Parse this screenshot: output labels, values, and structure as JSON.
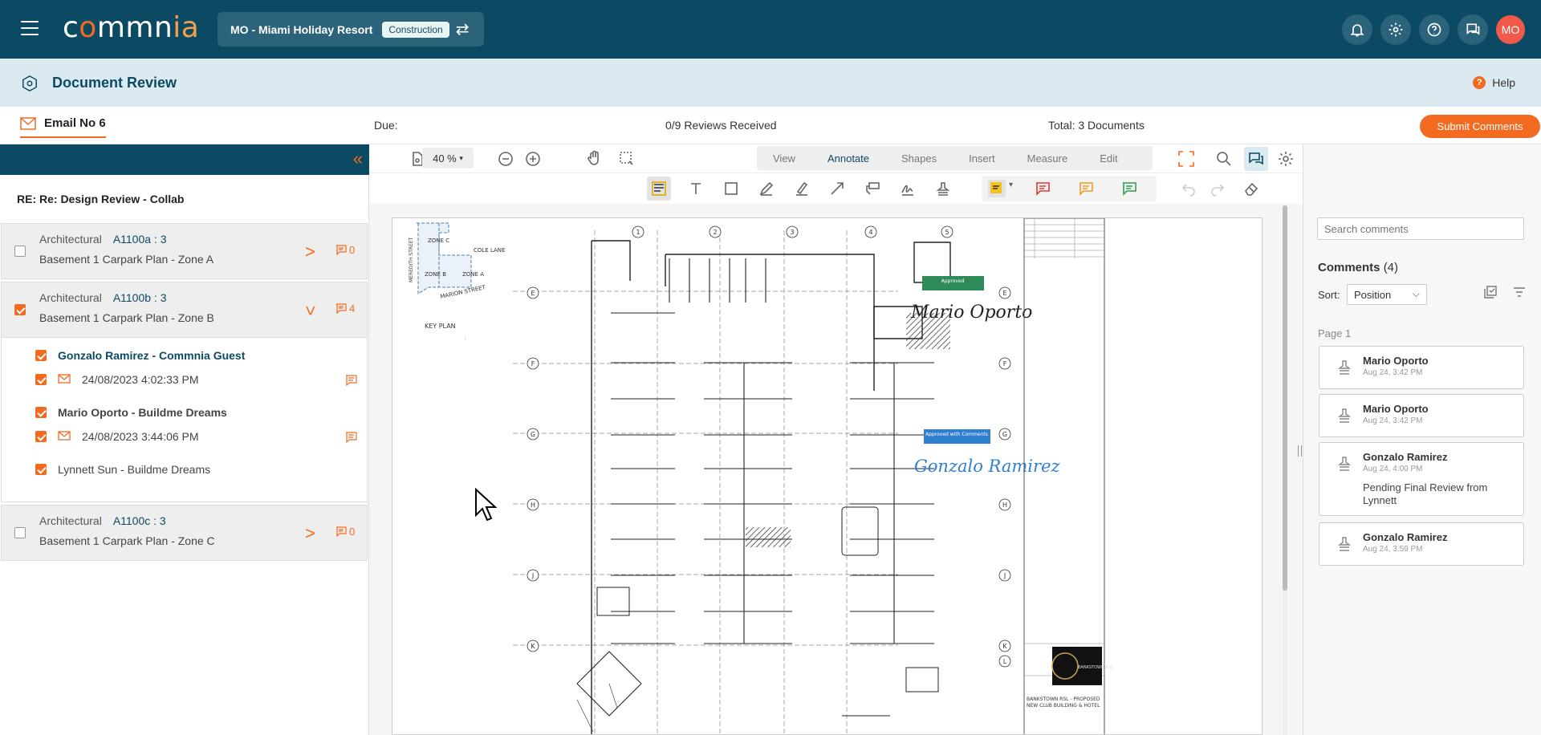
{
  "app": {
    "logo": {
      "c": "c",
      "o": "o",
      "mmn": "mmn",
      "ia": "ia"
    },
    "project": {
      "name": "MO - Miami Holiday Resort",
      "phase": "Construction"
    },
    "avatar_initials": "MO",
    "accent": "#f26b21",
    "primary": "#0c4a63"
  },
  "page": {
    "title": "Document Review",
    "help": "Help"
  },
  "info": {
    "email_tab": "Email No 6",
    "due": "Due:",
    "reviews": "0/9 Reviews Received",
    "total": "Total: 3 Documents",
    "submit": "Submit Comments"
  },
  "left": {
    "subject": "RE: Re: Design Review - Collab",
    "docs": [
      {
        "discipline": "Architectural",
        "code": "A1100a : 3",
        "name": "Basement 1 Carpark Plan - Zone A",
        "comments": "0"
      },
      {
        "discipline": "Architectural",
        "code": "A1100b : 3",
        "name": "Basement 1 Carpark Plan - Zone B",
        "comments": "4"
      },
      {
        "discipline": "Architectural",
        "code": "A1100c : 3",
        "name": "Basement 1 Carpark Plan - Zone C",
        "comments": "0"
      }
    ],
    "reviewers": [
      {
        "name": "Gonzalo Ramirez - Commnia Guest",
        "date": "24/08/2023 4:02:33 PM"
      },
      {
        "name": "Mario Oporto - Buildme Dreams",
        "date": "24/08/2023 3:44:06 PM"
      },
      {
        "name": "Lynnett Sun - Buildme Dreams"
      }
    ]
  },
  "viewer": {
    "zoom": "40 %",
    "modes": [
      "View",
      "Annotate",
      "Shapes",
      "Insert",
      "Measure",
      "Edit"
    ],
    "active_mode": "Annotate",
    "drawing": {
      "key_plan": "KEY PLAN",
      "zones": [
        "ZONE C",
        "ZONE B",
        "ZONE A"
      ],
      "streets": [
        "COLE LANE",
        "MARION STREET",
        "MEREDITH STREET"
      ],
      "grid_cols": [
        "1",
        "2",
        "3",
        "4",
        "5"
      ],
      "grid_rows": [
        "E",
        "F",
        "G",
        "H",
        "J",
        "K",
        "L"
      ],
      "stamp_approved": "Approved",
      "stamp_comments": "Approved with Comments",
      "sig1": "Mario Oporto",
      "sig2": "Gonzalo Ramirez",
      "title_block": [
        "BANKSTOWN RSL - PROPOSED",
        "NEW CLUB BUILDING & HOTEL"
      ],
      "logo_text": "BANKSTOWN RSL"
    }
  },
  "comments": {
    "search_placeholder": "Search comments",
    "title": "Comments",
    "count": "(4)",
    "sort_label": "Sort:",
    "sort_value": "Position",
    "page_label": "Page 1",
    "items": [
      {
        "author": "Mario Oporto",
        "date": "Aug 24, 3:42 PM"
      },
      {
        "author": "Mario Oporto",
        "date": "Aug 24, 3:42 PM"
      },
      {
        "author": "Gonzalo Ramirez",
        "date": "Aug 24, 4:00 PM",
        "text": "Pending Final Review from Lynnett"
      },
      {
        "author": "Gonzalo Ramirez",
        "date": "Aug 24, 3:59 PM"
      }
    ]
  }
}
